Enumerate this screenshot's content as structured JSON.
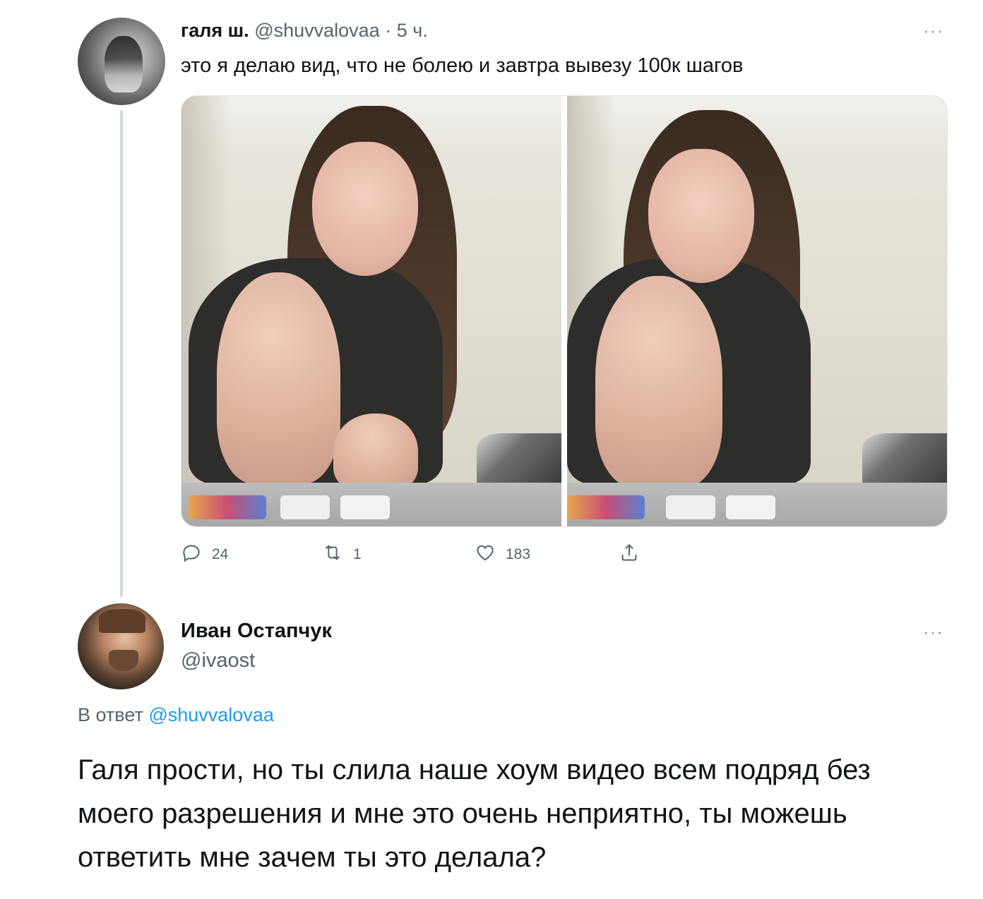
{
  "parent": {
    "display_name": "галя ш.",
    "handle": "@shuvvalovaa",
    "separator": "·",
    "time": "5 ч.",
    "more_label": "···",
    "text": "это я делаю вид, что не болею и завтра вывезу 100к шагов",
    "actions": {
      "reply_count": "24",
      "retweet_count": "1",
      "like_count": "183"
    }
  },
  "reply": {
    "display_name": "Иван Остапчук",
    "handle": "@ivaost",
    "more_label": "···",
    "reply_prefix": "В ответ",
    "reply_to_handle": "@shuvvalovaa",
    "text": "Галя прости, но ты слила наше хоум видео всем подряд без моего разрешения и мне это очень неприятно, ты можешь ответить мне зачем ты это делала?"
  },
  "icons": {
    "reply": "reply-icon",
    "retweet": "retweet-icon",
    "like": "heart-icon",
    "share": "share-icon"
  },
  "colors": {
    "text": "#0f1419",
    "muted": "#536471",
    "link": "#1d9bf0",
    "thread_line": "#cfd9de"
  }
}
